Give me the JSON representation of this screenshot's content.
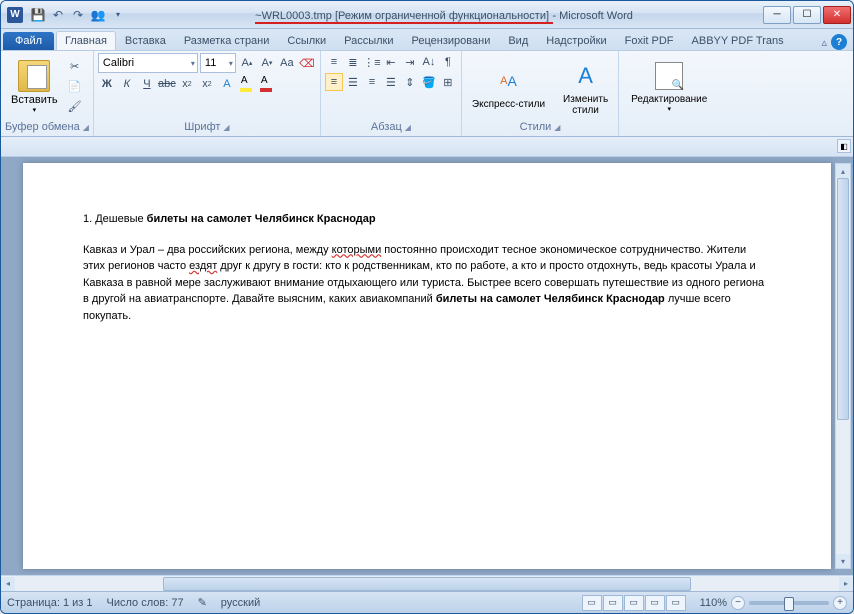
{
  "title": {
    "filename": "~WRL0003.tmp",
    "mode": "[Режим ограниченной функциональности]",
    "app": "Microsoft Word"
  },
  "tabs": {
    "file": "Файл",
    "items": [
      "Главная",
      "Вставка",
      "Разметка страни",
      "Ссылки",
      "Рассылки",
      "Рецензировани",
      "Вид",
      "Надстройки",
      "Foxit PDF",
      "ABBYY PDF Trans"
    ],
    "active_index": 0
  },
  "ribbon": {
    "clipboard": {
      "label": "Буфер обмена",
      "paste": "Вставить"
    },
    "font": {
      "label": "Шрифт",
      "name": "Calibri",
      "size": "11"
    },
    "paragraph": {
      "label": "Абзац"
    },
    "styles": {
      "label": "Стили",
      "quick": "Экспресс-стили",
      "change": "Изменить\nстили"
    },
    "editing": {
      "label": "Редактирование"
    }
  },
  "document": {
    "heading_prefix": "1. Дешевые ",
    "heading_bold": "билеты на самолет Челябинск Краснодар",
    "para_1a": "Кавказ и Урал – два российских региона, между ",
    "para_1b": "которыми",
    "para_1c": " постоянно происходит тесное экономическое сотрудничество. Жители этих регионов часто ",
    "para_1d": "ездят",
    "para_1e": " друг к другу в гости: кто к родственникам, кто по работе, а кто и просто отдохнуть, ведь красоты Урала и Кавказа в равной мере заслуживают внимание отдыхающего или туриста. Быстрее всего совершать путешествие из одного региона в другой на авиатранспорте. Давайте выясним, каких авиакомпаний ",
    "para_1f": "билеты на самолет Челябинск Краснодар",
    "para_1g": " лучше всего покупать."
  },
  "status": {
    "page": "Страница: 1 из 1",
    "words": "Число слов: 77",
    "lang": "русский",
    "zoom": "110%"
  }
}
